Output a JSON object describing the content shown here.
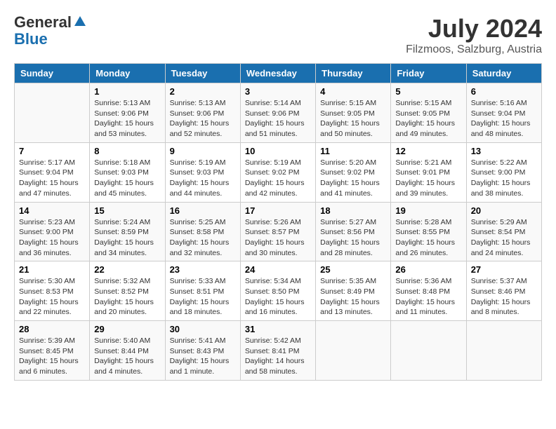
{
  "header": {
    "logo_line1": "General",
    "logo_line2": "Blue",
    "month_year": "July 2024",
    "location": "Filzmoos, Salzburg, Austria"
  },
  "days_of_week": [
    "Sunday",
    "Monday",
    "Tuesday",
    "Wednesday",
    "Thursday",
    "Friday",
    "Saturday"
  ],
  "weeks": [
    [
      {
        "day": "",
        "info": ""
      },
      {
        "day": "1",
        "info": "Sunrise: 5:13 AM\nSunset: 9:06 PM\nDaylight: 15 hours\nand 53 minutes."
      },
      {
        "day": "2",
        "info": "Sunrise: 5:13 AM\nSunset: 9:06 PM\nDaylight: 15 hours\nand 52 minutes."
      },
      {
        "day": "3",
        "info": "Sunrise: 5:14 AM\nSunset: 9:06 PM\nDaylight: 15 hours\nand 51 minutes."
      },
      {
        "day": "4",
        "info": "Sunrise: 5:15 AM\nSunset: 9:05 PM\nDaylight: 15 hours\nand 50 minutes."
      },
      {
        "day": "5",
        "info": "Sunrise: 5:15 AM\nSunset: 9:05 PM\nDaylight: 15 hours\nand 49 minutes."
      },
      {
        "day": "6",
        "info": "Sunrise: 5:16 AM\nSunset: 9:04 PM\nDaylight: 15 hours\nand 48 minutes."
      }
    ],
    [
      {
        "day": "7",
        "info": "Sunrise: 5:17 AM\nSunset: 9:04 PM\nDaylight: 15 hours\nand 47 minutes."
      },
      {
        "day": "8",
        "info": "Sunrise: 5:18 AM\nSunset: 9:03 PM\nDaylight: 15 hours\nand 45 minutes."
      },
      {
        "day": "9",
        "info": "Sunrise: 5:19 AM\nSunset: 9:03 PM\nDaylight: 15 hours\nand 44 minutes."
      },
      {
        "day": "10",
        "info": "Sunrise: 5:19 AM\nSunset: 9:02 PM\nDaylight: 15 hours\nand 42 minutes."
      },
      {
        "day": "11",
        "info": "Sunrise: 5:20 AM\nSunset: 9:02 PM\nDaylight: 15 hours\nand 41 minutes."
      },
      {
        "day": "12",
        "info": "Sunrise: 5:21 AM\nSunset: 9:01 PM\nDaylight: 15 hours\nand 39 minutes."
      },
      {
        "day": "13",
        "info": "Sunrise: 5:22 AM\nSunset: 9:00 PM\nDaylight: 15 hours\nand 38 minutes."
      }
    ],
    [
      {
        "day": "14",
        "info": "Sunrise: 5:23 AM\nSunset: 9:00 PM\nDaylight: 15 hours\nand 36 minutes."
      },
      {
        "day": "15",
        "info": "Sunrise: 5:24 AM\nSunset: 8:59 PM\nDaylight: 15 hours\nand 34 minutes."
      },
      {
        "day": "16",
        "info": "Sunrise: 5:25 AM\nSunset: 8:58 PM\nDaylight: 15 hours\nand 32 minutes."
      },
      {
        "day": "17",
        "info": "Sunrise: 5:26 AM\nSunset: 8:57 PM\nDaylight: 15 hours\nand 30 minutes."
      },
      {
        "day": "18",
        "info": "Sunrise: 5:27 AM\nSunset: 8:56 PM\nDaylight: 15 hours\nand 28 minutes."
      },
      {
        "day": "19",
        "info": "Sunrise: 5:28 AM\nSunset: 8:55 PM\nDaylight: 15 hours\nand 26 minutes."
      },
      {
        "day": "20",
        "info": "Sunrise: 5:29 AM\nSunset: 8:54 PM\nDaylight: 15 hours\nand 24 minutes."
      }
    ],
    [
      {
        "day": "21",
        "info": "Sunrise: 5:30 AM\nSunset: 8:53 PM\nDaylight: 15 hours\nand 22 minutes."
      },
      {
        "day": "22",
        "info": "Sunrise: 5:32 AM\nSunset: 8:52 PM\nDaylight: 15 hours\nand 20 minutes."
      },
      {
        "day": "23",
        "info": "Sunrise: 5:33 AM\nSunset: 8:51 PM\nDaylight: 15 hours\nand 18 minutes."
      },
      {
        "day": "24",
        "info": "Sunrise: 5:34 AM\nSunset: 8:50 PM\nDaylight: 15 hours\nand 16 minutes."
      },
      {
        "day": "25",
        "info": "Sunrise: 5:35 AM\nSunset: 8:49 PM\nDaylight: 15 hours\nand 13 minutes."
      },
      {
        "day": "26",
        "info": "Sunrise: 5:36 AM\nSunset: 8:48 PM\nDaylight: 15 hours\nand 11 minutes."
      },
      {
        "day": "27",
        "info": "Sunrise: 5:37 AM\nSunset: 8:46 PM\nDaylight: 15 hours\nand 8 minutes."
      }
    ],
    [
      {
        "day": "28",
        "info": "Sunrise: 5:39 AM\nSunset: 8:45 PM\nDaylight: 15 hours\nand 6 minutes."
      },
      {
        "day": "29",
        "info": "Sunrise: 5:40 AM\nSunset: 8:44 PM\nDaylight: 15 hours\nand 4 minutes."
      },
      {
        "day": "30",
        "info": "Sunrise: 5:41 AM\nSunset: 8:43 PM\nDaylight: 15 hours\nand 1 minute."
      },
      {
        "day": "31",
        "info": "Sunrise: 5:42 AM\nSunset: 8:41 PM\nDaylight: 14 hours\nand 58 minutes."
      },
      {
        "day": "",
        "info": ""
      },
      {
        "day": "",
        "info": ""
      },
      {
        "day": "",
        "info": ""
      }
    ]
  ]
}
